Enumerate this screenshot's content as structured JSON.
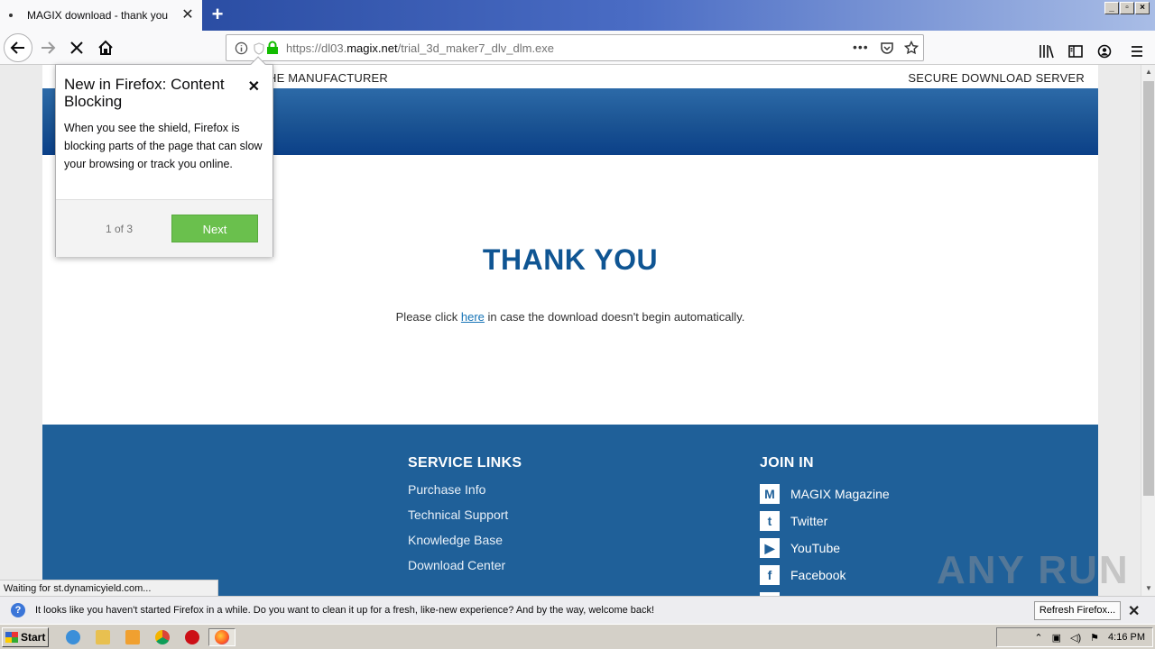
{
  "browser": {
    "tab_title": "MAGIX download - thank you",
    "url_prefix": "https://dl03.",
    "url_domain": "magix.net",
    "url_path": "/trial_3d_maker7_dlv_dlm.exe"
  },
  "page": {
    "topline_left": "HE MANUFACTURER",
    "topline_right": "SECURE DOWNLOAD SERVER",
    "heading": "THANK YOU",
    "click_before": "Please click ",
    "click_link": "here",
    "click_after": " in case the download doesn't begin automatically.",
    "service_title": "SERVICE LINKS",
    "service_links": [
      "Purchase Info",
      "Technical Support",
      "Knowledge Base",
      "Download Center"
    ],
    "join_title": "JOIN IN",
    "social": [
      "MAGIX Magazine",
      "Twitter",
      "YouTube",
      "Facebook"
    ]
  },
  "popup": {
    "title": "New in Firefox: Content Blocking",
    "body": "When you see the shield, Firefox is blocking parts of the page that can slow your browsing or track you online.",
    "count": "1 of 3",
    "next": "Next"
  },
  "status": "Waiting for st.dynamicyield.com...",
  "watermark": "ANY RUN",
  "notification": {
    "text": "It looks like you haven't started Firefox in a while. Do you want to clean it up for a fresh, like-new experience? And by the way, welcome back!",
    "button": "Refresh Firefox..."
  },
  "taskbar": {
    "start": "Start",
    "clock": "4:16 PM"
  },
  "colors": {
    "brand_blue": "#1f6099",
    "heading_blue": "#0f5593",
    "next_green": "#6ac04d"
  }
}
